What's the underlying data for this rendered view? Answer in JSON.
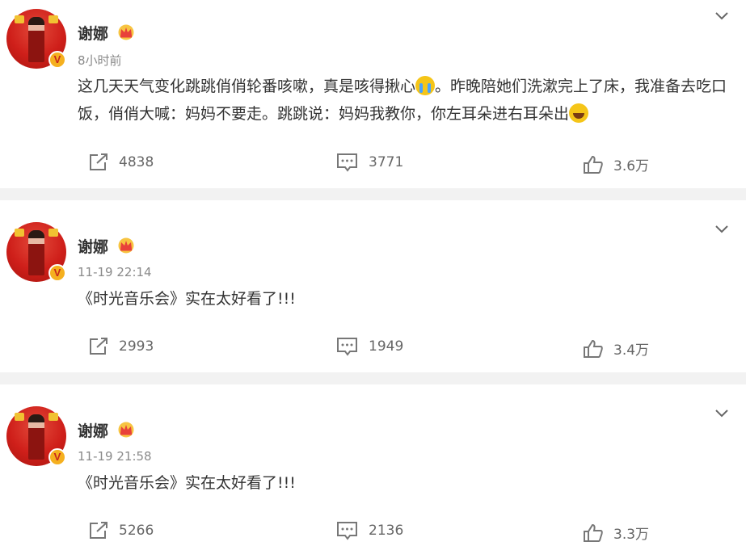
{
  "posts": [
    {
      "author": "谢娜",
      "time": "8小时前",
      "text_parts": [
        "这几天天气变化跳跳俏俏轮番咳嗽，真是咳得揪心",
        "。昨晚陪她们洗漱完上了床，我准备去吃口饭，俏俏大喊：妈妈不要走。跳跳说：妈妈我教你，你左耳朵进右耳朵出"
      ],
      "emojis": [
        "crying-emoji",
        "laughing-emoji"
      ],
      "repost_count": "4838",
      "comment_count": "3771",
      "like_count": "3.6万"
    },
    {
      "author": "谢娜",
      "time": "11-19 22:14",
      "text": "《时光音乐会》实在太好看了!!!",
      "repost_count": "2993",
      "comment_count": "1949",
      "like_count": "3.4万"
    },
    {
      "author": "谢娜",
      "time": "11-19 21:58",
      "text": "《时光音乐会》实在太好看了!!!",
      "repost_count": "5266",
      "comment_count": "2136",
      "like_count": "3.3万"
    }
  ],
  "verified_badge": "V",
  "colors": {
    "accent": "#f5b01f",
    "avatar_bg": "#cf1f1a",
    "divider": "#f2f2f2"
  },
  "icons": [
    "share-icon",
    "comment-icon",
    "like-icon",
    "chevron-down-icon",
    "crown-badge-icon",
    "verified-icon"
  ]
}
